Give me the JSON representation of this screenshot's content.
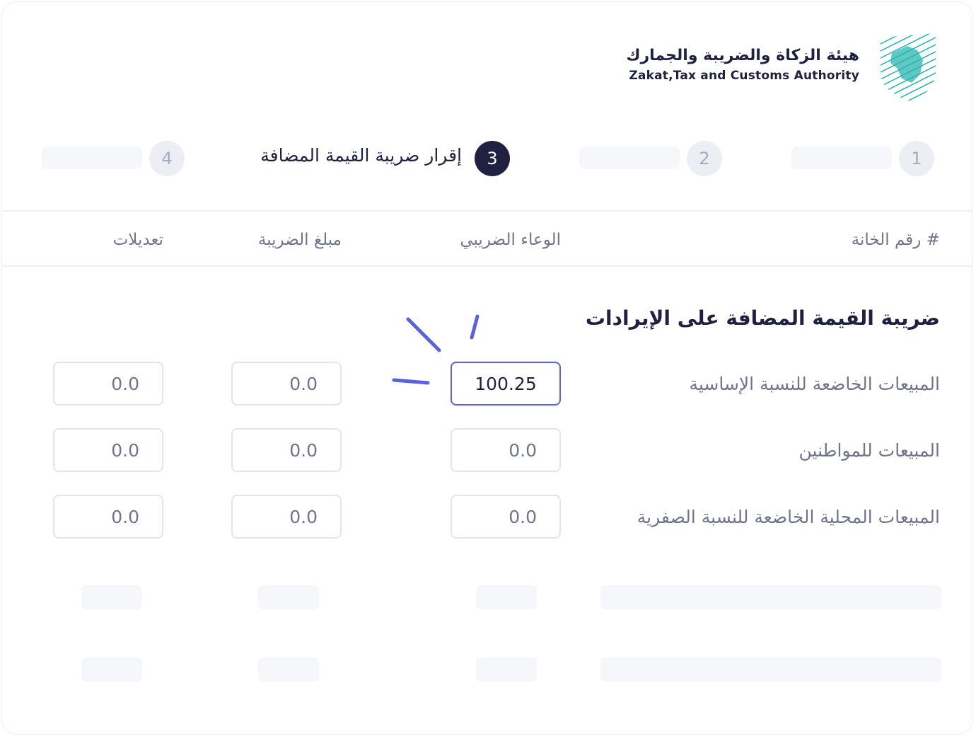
{
  "header": {
    "authority_name_ar": "هيئة الزكاة والضريبة والجمارك",
    "authority_name_en": "Zakat,Tax and Customs Authority",
    "logo_icon": "zatca-shield-logo"
  },
  "stepper": {
    "steps": [
      {
        "number": "1",
        "label": "",
        "active": false
      },
      {
        "number": "2",
        "label": "",
        "active": false
      },
      {
        "number": "3",
        "label": "إقرار ضريبة القيمة المضافة",
        "active": true
      },
      {
        "number": "4",
        "label": "",
        "active": false
      }
    ]
  },
  "table": {
    "headers": {
      "box_number": "# رقم الخانة",
      "tax_base": "الوعاء الضريبي",
      "tax_amount": "مبلغ الضريبة",
      "adjustments": "تعديلات"
    },
    "section_title": "ضريبة القيمة المضافة على الإيرادات",
    "rows": [
      {
        "label": "المبيعات الخاضعة للنسبة الإساسية",
        "tax_base": "100.25",
        "tax_amount": "0.0",
        "adjustments": "0.0",
        "focused": true
      },
      {
        "label": "المبيعات للمواطنين",
        "tax_base": "0.0",
        "tax_amount": "0.0",
        "adjustments": "0.0",
        "focused": false
      },
      {
        "label": "المبيعات المحلية الخاضعة للنسبة الصفرية",
        "tax_base": "0.0",
        "tax_amount": "0.0",
        "adjustments": "0.0",
        "focused": false
      }
    ]
  },
  "colors": {
    "primary_dark": "#1e2140",
    "focus_accent": "#5a63db",
    "logo_teal": "#2bb5b0",
    "muted_text": "#6f748c"
  }
}
